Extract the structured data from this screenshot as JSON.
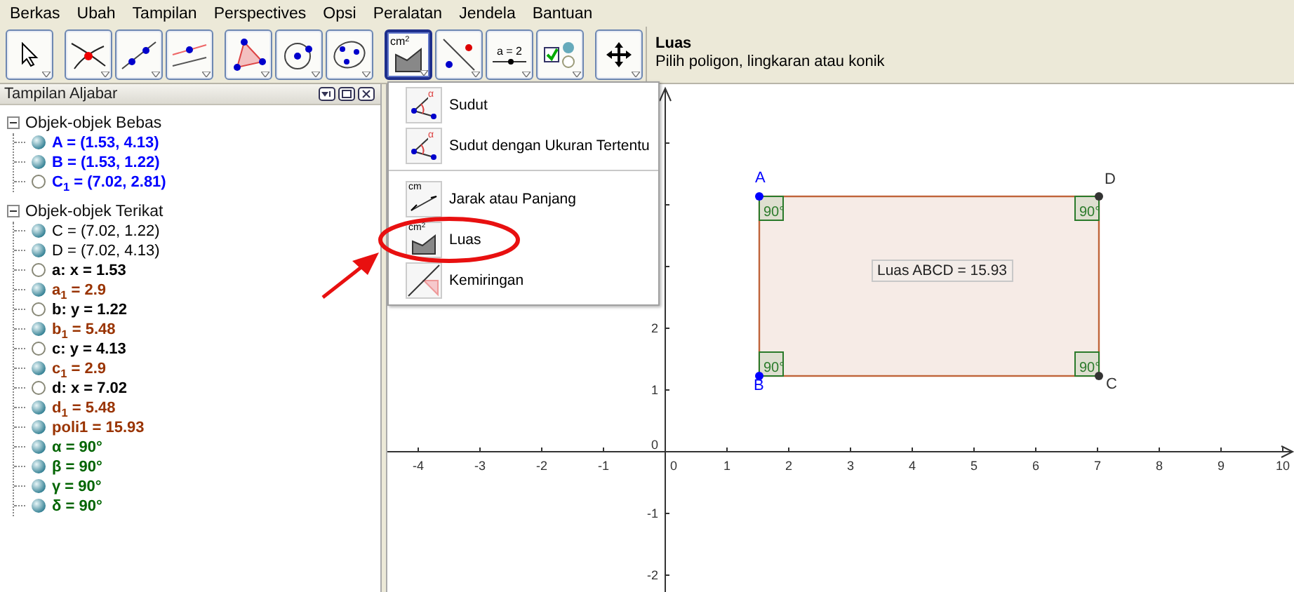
{
  "menu_bar": [
    "Berkas",
    "Ubah",
    "Tampilan",
    "Perspectives",
    "Opsi",
    "Peralatan",
    "Jendela",
    "Bantuan"
  ],
  "toolbar": {
    "groups": [
      [
        {
          "kind": "move",
          "selected": false
        }
      ],
      [
        {
          "kind": "intersect",
          "selected": false
        },
        {
          "kind": "line",
          "selected": false
        },
        {
          "kind": "parallel",
          "selected": false
        }
      ],
      [
        {
          "kind": "polygon",
          "selected": false
        },
        {
          "kind": "circle",
          "selected": false
        },
        {
          "kind": "conic",
          "selected": false
        }
      ],
      [
        {
          "kind": "area",
          "selected": true,
          "icon_text": "cm$^{2}$"
        },
        {
          "kind": "reflect",
          "selected": false
        },
        {
          "kind": "slider",
          "selected": false,
          "icon_text": "a = 2"
        },
        {
          "kind": "checkbox",
          "selected": false
        }
      ],
      [
        {
          "kind": "pan",
          "selected": false
        }
      ]
    ],
    "tool_info": {
      "title": "Luas",
      "description": "Pilih poligon, lingkaran atau konik"
    }
  },
  "algebra_view": {
    "title": "Tampilan Aljabar",
    "groups": [
      {
        "label": "Objek-objek Bebas",
        "expanded": true,
        "items": [
          {
            "text": "A = (1.53, 4.13)",
            "color": "#0000ff",
            "shown": true,
            "bold": true
          },
          {
            "text": "B = (1.53, 1.22)",
            "color": "#0000ff",
            "shown": true,
            "bold": true
          },
          {
            "text": "C$_{1}$ = (7.02, 2.81)",
            "color": "#0000ff",
            "shown": false,
            "bold": true
          }
        ]
      },
      {
        "label": "Objek-objek Terikat",
        "expanded": true,
        "items": [
          {
            "text": "C = (7.02, 1.22)",
            "color": "#000000",
            "shown": true,
            "bold": false
          },
          {
            "text": "D = (7.02, 4.13)",
            "color": "#000000",
            "shown": true,
            "bold": false
          },
          {
            "text": "a: x = 1.53",
            "color": "#000000",
            "shown": false,
            "bold": true
          },
          {
            "text": "a$_{1}$ = 2.9",
            "color": "#993300",
            "shown": true,
            "bold": true
          },
          {
            "text": "b: y = 1.22",
            "color": "#000000",
            "shown": false,
            "bold": true
          },
          {
            "text": "b$_{1}$ = 5.48",
            "color": "#993300",
            "shown": true,
            "bold": true
          },
          {
            "text": "c: y = 4.13",
            "color": "#000000",
            "shown": false,
            "bold": true
          },
          {
            "text": "c$_{1}$ = 2.9",
            "color": "#993300",
            "shown": true,
            "bold": true
          },
          {
            "text": "d: x = 7.02",
            "color": "#000000",
            "shown": false,
            "bold": true
          },
          {
            "text": "d$_{1}$ = 5.48",
            "color": "#993300",
            "shown": true,
            "bold": true
          },
          {
            "text": "poli1 = 15.93",
            "color": "#993300",
            "shown": true,
            "bold": true
          },
          {
            "text": "α = 90°",
            "color": "#006400",
            "shown": true,
            "bold": true
          },
          {
            "text": "β = 90°",
            "color": "#006400",
            "shown": true,
            "bold": true
          },
          {
            "text": "γ = 90°",
            "color": "#006400",
            "shown": true,
            "bold": true
          },
          {
            "text": "δ = 90°",
            "color": "#006400",
            "shown": true,
            "bold": true
          }
        ]
      }
    ]
  },
  "tool_menu": {
    "sections": [
      [
        {
          "kind": "angle",
          "label": "Sudut",
          "icon_text": "α"
        },
        {
          "kind": "fixed-angle",
          "label": "Sudut dengan Ukuran Tertentu",
          "icon_text": "α"
        }
      ],
      [
        {
          "kind": "distance",
          "label": "Jarak atau Panjang",
          "icon_text": "cm"
        },
        {
          "kind": "area",
          "label": "Luas",
          "icon_text": "cm$^{2}$"
        },
        {
          "kind": "slope",
          "label": "Kemiringan"
        }
      ]
    ]
  },
  "graphics": {
    "x_labels": [
      "-4",
      "-3",
      "-2",
      "-1",
      "0",
      "1",
      "2",
      "3",
      "4",
      "5",
      "6",
      "7",
      "8",
      "9",
      "10"
    ],
    "y_labels": [
      "2",
      "1",
      "0",
      "-1",
      "-2"
    ],
    "points": [
      {
        "label": "A",
        "color": "#0000ff"
      },
      {
        "label": "D",
        "color": "#333333"
      },
      {
        "label": "B",
        "color": "#0000ff"
      },
      {
        "label": "C",
        "color": "#333333"
      }
    ],
    "angles": [
      "90°",
      "90°",
      "90°",
      "90°"
    ],
    "polygon_label": "Luas ABCD = 15.93"
  }
}
